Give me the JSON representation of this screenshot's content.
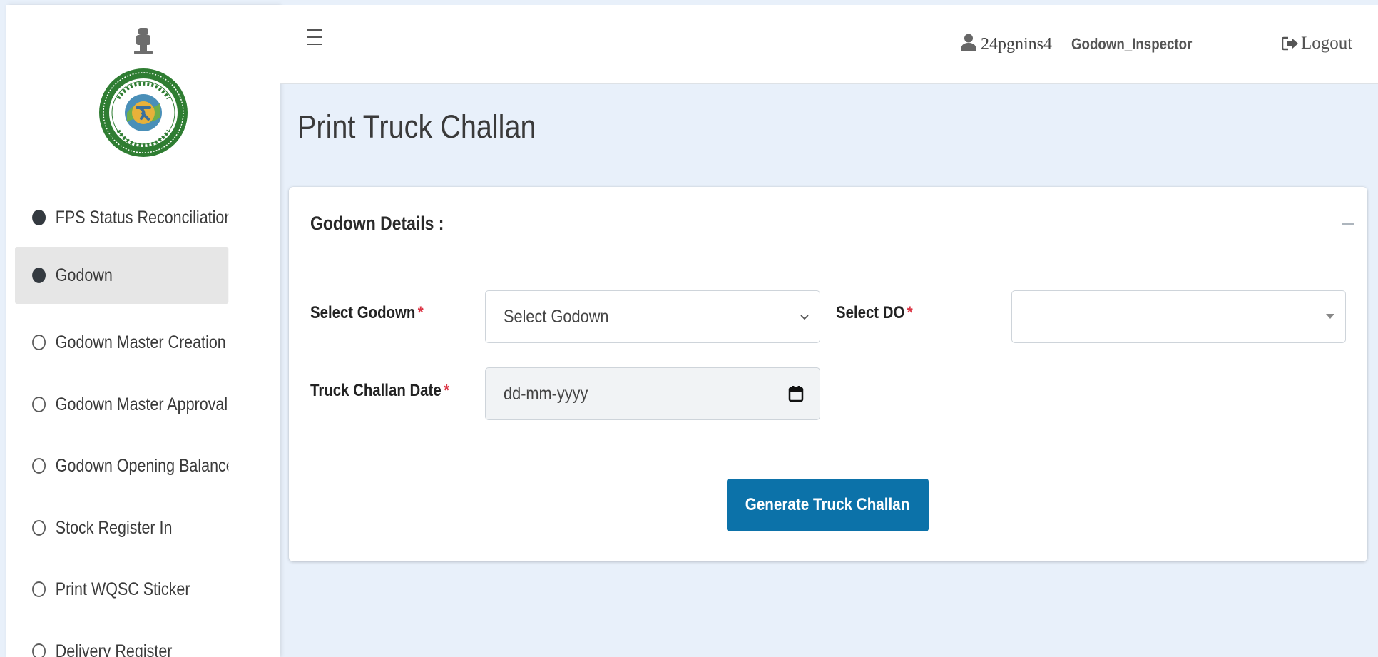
{
  "sidebar": {
    "logo_icon": "west-bengal-emblem",
    "items": [
      {
        "label": "FPS Status Reconciliation",
        "marker": "filled"
      },
      {
        "label": "Godown",
        "marker": "filled",
        "active": true
      },
      {
        "label": "Godown Master Creation",
        "marker": "empty"
      },
      {
        "label": "Godown Master Approval (Se",
        "marker": "empty"
      },
      {
        "label": "Godown Opening Balance Er",
        "marker": "empty"
      },
      {
        "label": "Stock Register In",
        "marker": "empty"
      },
      {
        "label": "Print WQSC Sticker",
        "marker": "empty"
      },
      {
        "label": "Delivery Register",
        "marker": "empty"
      }
    ]
  },
  "header": {
    "menu_icon": "hamburger-icon",
    "user_icon": "user-icon",
    "username": "24pgnins4",
    "role": "Godown_Inspector",
    "logout_icon": "sign-out-icon",
    "logout_label": "Logout"
  },
  "page": {
    "title": "Print Truck Challan"
  },
  "card": {
    "title": "Godown Details :",
    "collapse_icon": "minus-icon",
    "form": {
      "godown_label": "Select Godown",
      "godown_value": "Select Godown",
      "do_label": "Select DO",
      "do_value": "",
      "date_label": "Truck Challan Date",
      "date_placeholder": "dd-mm-yyyy",
      "required_marker": "*",
      "submit_label": "Generate Truck Challan"
    }
  },
  "colors": {
    "primary": "#0c72a9",
    "required": "#dc3545",
    "background": "#e8f0fa",
    "sidebar_active": "#e6e6e6"
  }
}
